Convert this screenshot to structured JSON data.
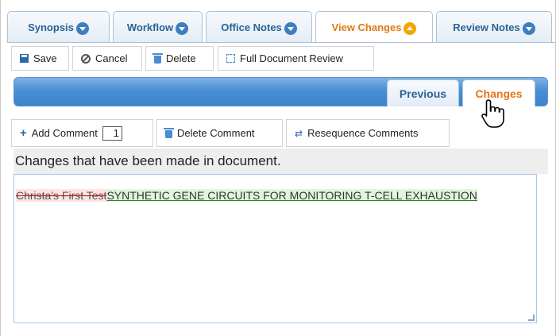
{
  "tabs": [
    {
      "label": "Synopsis",
      "active": false
    },
    {
      "label": "Workflow",
      "active": false
    },
    {
      "label": "Office Notes",
      "active": false
    },
    {
      "label": "View Changes",
      "active": true
    },
    {
      "label": "Review Notes",
      "active": false
    }
  ],
  "toolbar": {
    "save_label": "Save",
    "cancel_label": "Cancel",
    "delete_label": "Delete",
    "full_review_label": "Full Document Review"
  },
  "subtabs": {
    "previous_label": "Previous",
    "changes_label": "Changes",
    "active": "Changes"
  },
  "comments_toolbar": {
    "add_label": "Add Comment",
    "counter_value": "1",
    "delete_label": "Delete Comment",
    "resequence_label": "Resequence Comments"
  },
  "changes": {
    "heading": "Changes that have been made in document.",
    "deleted_text": "Christa's First Test",
    "inserted_text": "SYNTHETIC GENE CIRCUITS FOR MONITORING T-CELL EXHAUSTION"
  },
  "colors": {
    "tab_text": "#2a6396",
    "active_tab_text": "#e17814",
    "banner_blue": "#4a8fd3",
    "deleted_bg": "#fde4e4",
    "inserted_bg": "#e2f5dc"
  }
}
